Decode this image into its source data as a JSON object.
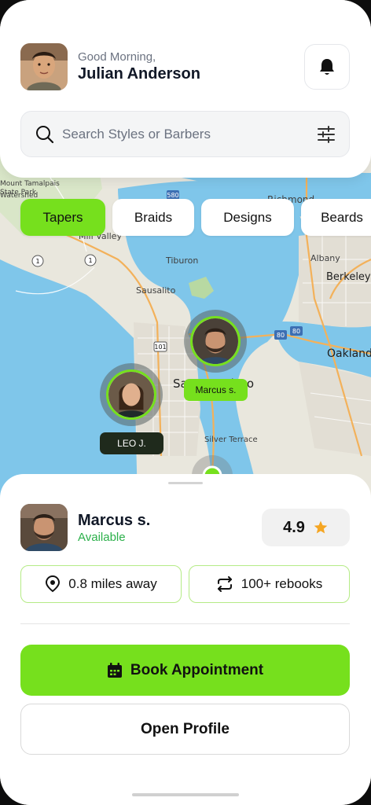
{
  "user": {
    "greeting": "Good Morning,",
    "name": "Julian Anderson"
  },
  "search": {
    "placeholder": "Search Styles or Barbers"
  },
  "chips": [
    {
      "label": "Tapers",
      "active": true
    },
    {
      "label": "Braids",
      "active": false
    },
    {
      "label": "Designs",
      "active": false
    },
    {
      "label": "Beards",
      "active": false
    }
  ],
  "map": {
    "labels": [
      "Mill Valley",
      "Tiburon",
      "Sausalito",
      "Albany",
      "Berkeley",
      "Oakland",
      "Silver Terrace",
      "San Francisco",
      "Richmond",
      "Mount Tamalpais",
      "State Park",
      "Watershed"
    ],
    "route_shields": [
      "580",
      "80",
      "580",
      "80",
      "101",
      "1",
      "1"
    ]
  },
  "pins": {
    "marcus_label": "Marcus s.",
    "leo_label": "LEO J."
  },
  "barber": {
    "name": "Marcus s.",
    "status": "Available",
    "rating": "4.9",
    "distance": "0.8 miles away",
    "rebooks": "100+ rebooks"
  },
  "actions": {
    "book": "Book Appointment",
    "profile": "Open Profile"
  },
  "colors": {
    "accent": "#76e01d",
    "water": "#7fc6ea",
    "land": "#eceae2",
    "available": "#2bb04a"
  },
  "icons": [
    "bell-icon",
    "search-icon",
    "filter-icon",
    "location-pin-icon",
    "repeat-icon",
    "star-icon",
    "calendar-icon"
  ]
}
